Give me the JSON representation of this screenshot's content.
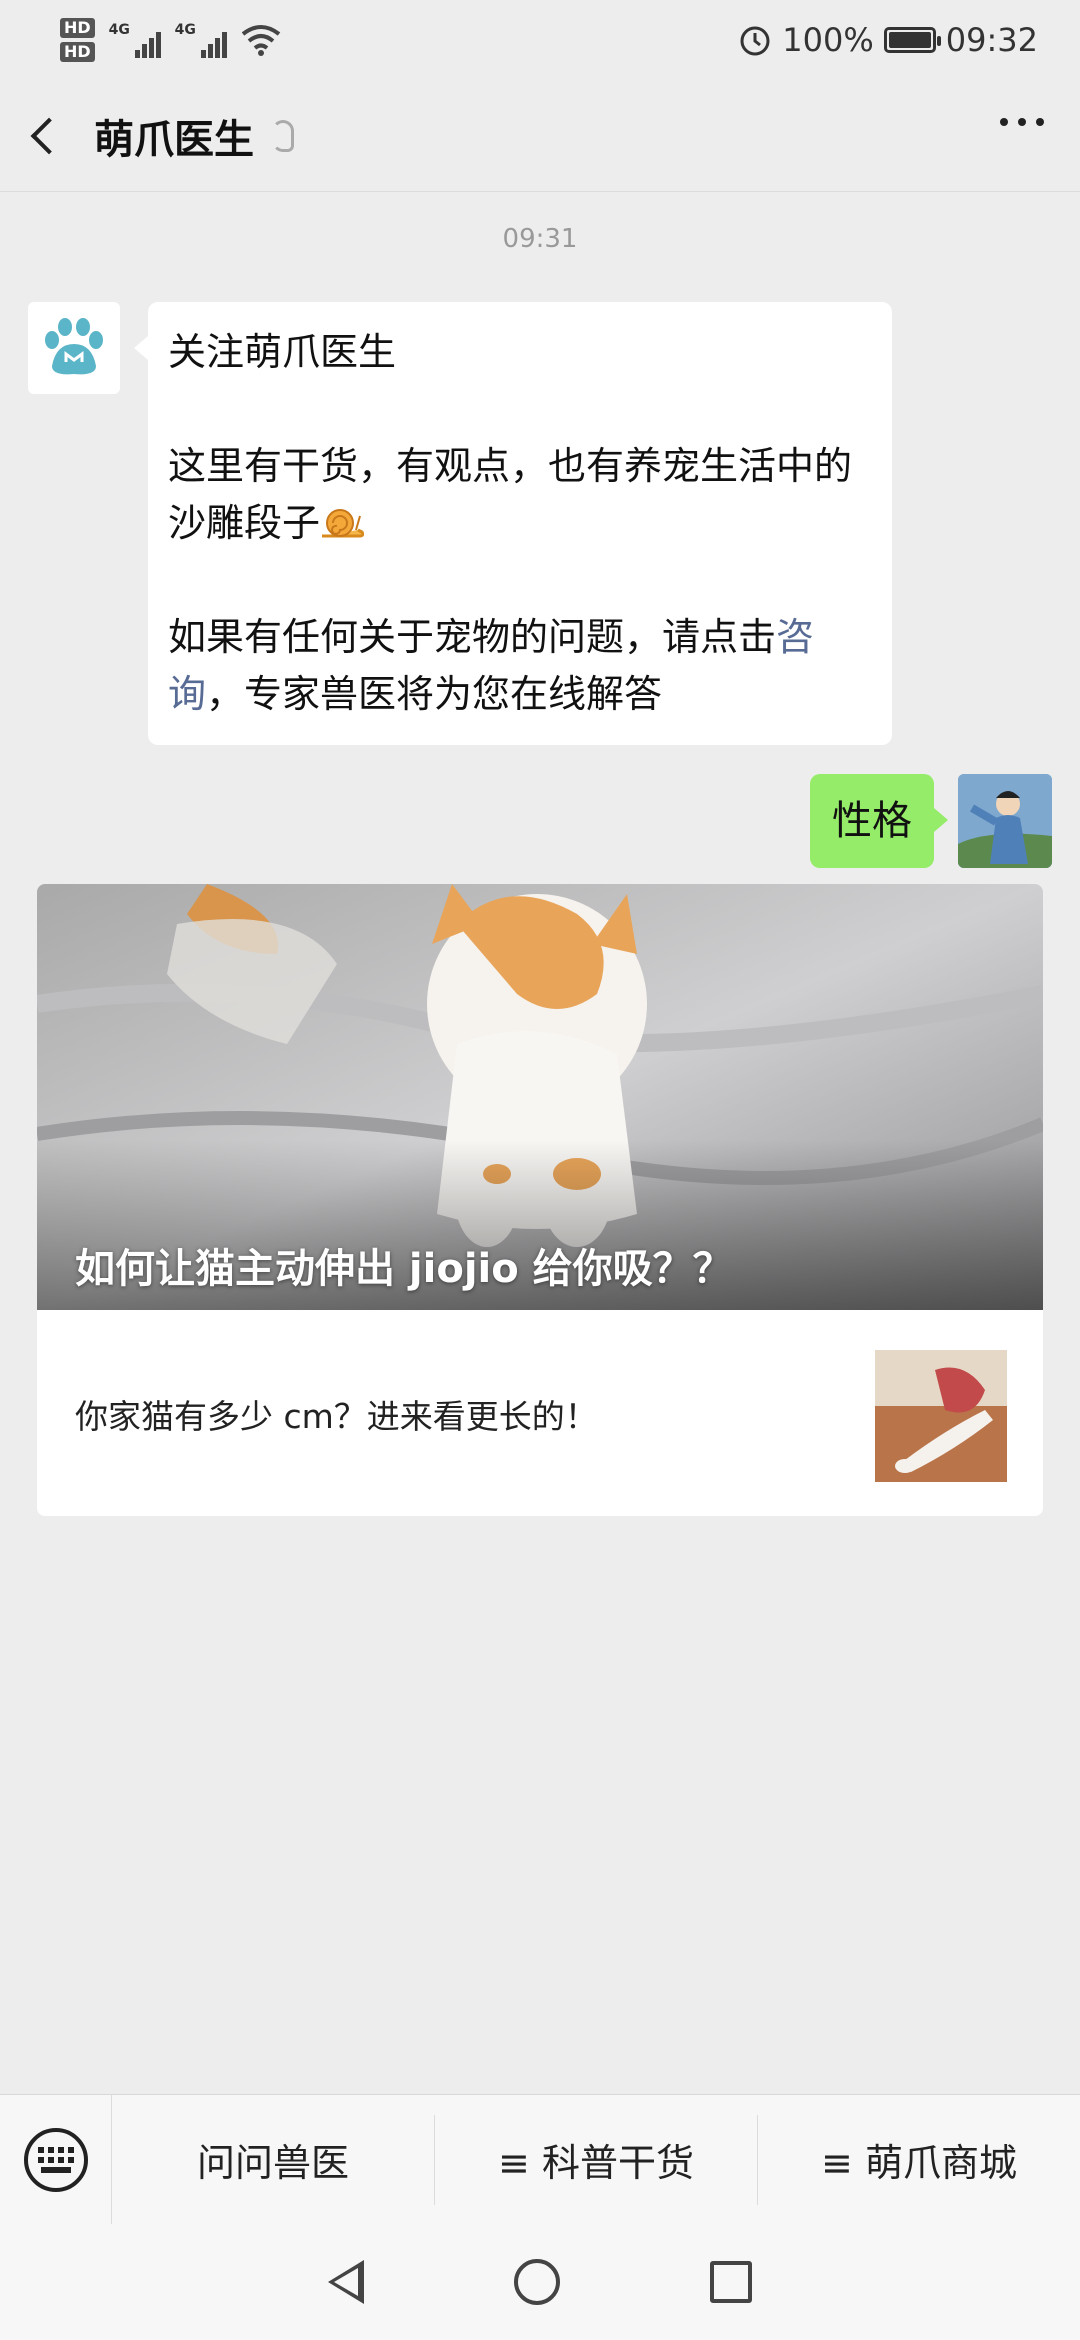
{
  "status_bar": {
    "hd1": "HD",
    "hd2": "HD",
    "net1": "4G",
    "net2": "4G",
    "battery": "100%",
    "time": "09:32"
  },
  "nav": {
    "title": "萌爪医生",
    "back_icon": "chevron-left-icon",
    "ear_icon": "ear-icon",
    "more_icon": "more-dots-icon"
  },
  "chat": {
    "timestamp": "09:31",
    "incoming": {
      "line1": "关注萌爪医生",
      "line2": "这里有干货，有观点，也有养宠生活中的沙雕段子",
      "line3_pre": "如果有任何关于宠物的问题，请点击",
      "line3_link": "咨询",
      "line3_post": "，专家兽医将为您在线解答"
    },
    "outgoing": {
      "text": "性格"
    },
    "article": {
      "cover_title": "如何让猫主动伸出 jiojio 给你吸？？",
      "subtitle": "你家猫有多少 cm？进来看更长的！"
    }
  },
  "menu": {
    "keyboard_icon": "keyboard-icon",
    "items": [
      "问问兽医",
      "≡ 科普干货",
      "≡ 萌爪商城"
    ]
  },
  "colors": {
    "background": "#ededed",
    "outgoing_bubble": "#95ec69",
    "link": "#576b95"
  }
}
